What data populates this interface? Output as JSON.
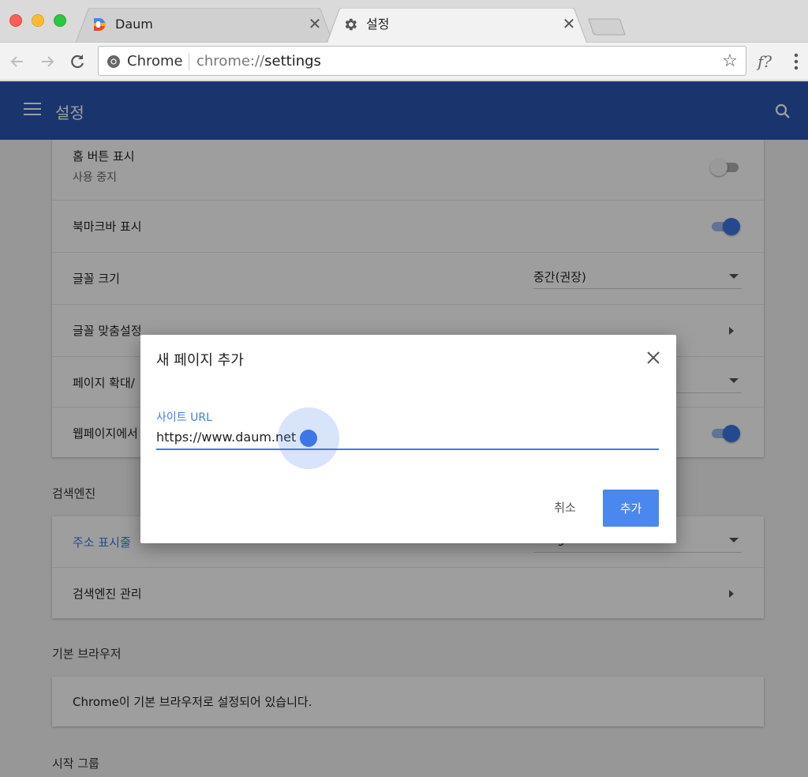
{
  "browser": {
    "tabs": [
      {
        "title": "Daum",
        "icon": "daum-favicon",
        "active": false
      },
      {
        "title": "설정",
        "icon": "gear-icon",
        "active": true
      }
    ],
    "tab_close_glyph": "✕",
    "omnibox": {
      "site_chip": "Chrome",
      "url_prefix": "chrome://",
      "url_path": "settings"
    },
    "extension_glyph": "f?",
    "bookmark_star_glyph": "☆"
  },
  "settings": {
    "header_title": "설정",
    "appearance": {
      "home_button": {
        "label": "홈 버튼 표시",
        "sub": "사용 중지",
        "enabled": false
      },
      "bookmark_bar": {
        "label": "북마크바 표시",
        "enabled": true
      },
      "font_size": {
        "label": "글꼴 크기",
        "value": "중간(권장)"
      },
      "customize_fonts": {
        "label": "글꼴 맞춤설정"
      },
      "page_zoom": {
        "label": "페이지 확대/"
      },
      "web_pages": {
        "label": "웹페이지에서",
        "enabled": true
      }
    },
    "search_engine": {
      "section_title": "검색엔진",
      "address_bar": {
        "label": "주소 표시줄",
        "value": "Google"
      },
      "manage": {
        "label": "검색엔진 관리"
      }
    },
    "default_browser": {
      "section_title": "기본 브라우저",
      "status": "Chrome이 기본 브라우저로 설정되어 있습니다."
    },
    "startup": {
      "section_title": "시작 그룹"
    }
  },
  "dialog": {
    "title": "새 페이지 추가",
    "close_glyph": "✕",
    "field_label": "사이트 URL",
    "field_value": "https://www.daum.net",
    "cancel_label": "취소",
    "add_label": "추가"
  },
  "colors": {
    "header_blue": "#2b56b0",
    "accent_blue": "#3e76e6",
    "button_blue": "#4a87ee"
  }
}
